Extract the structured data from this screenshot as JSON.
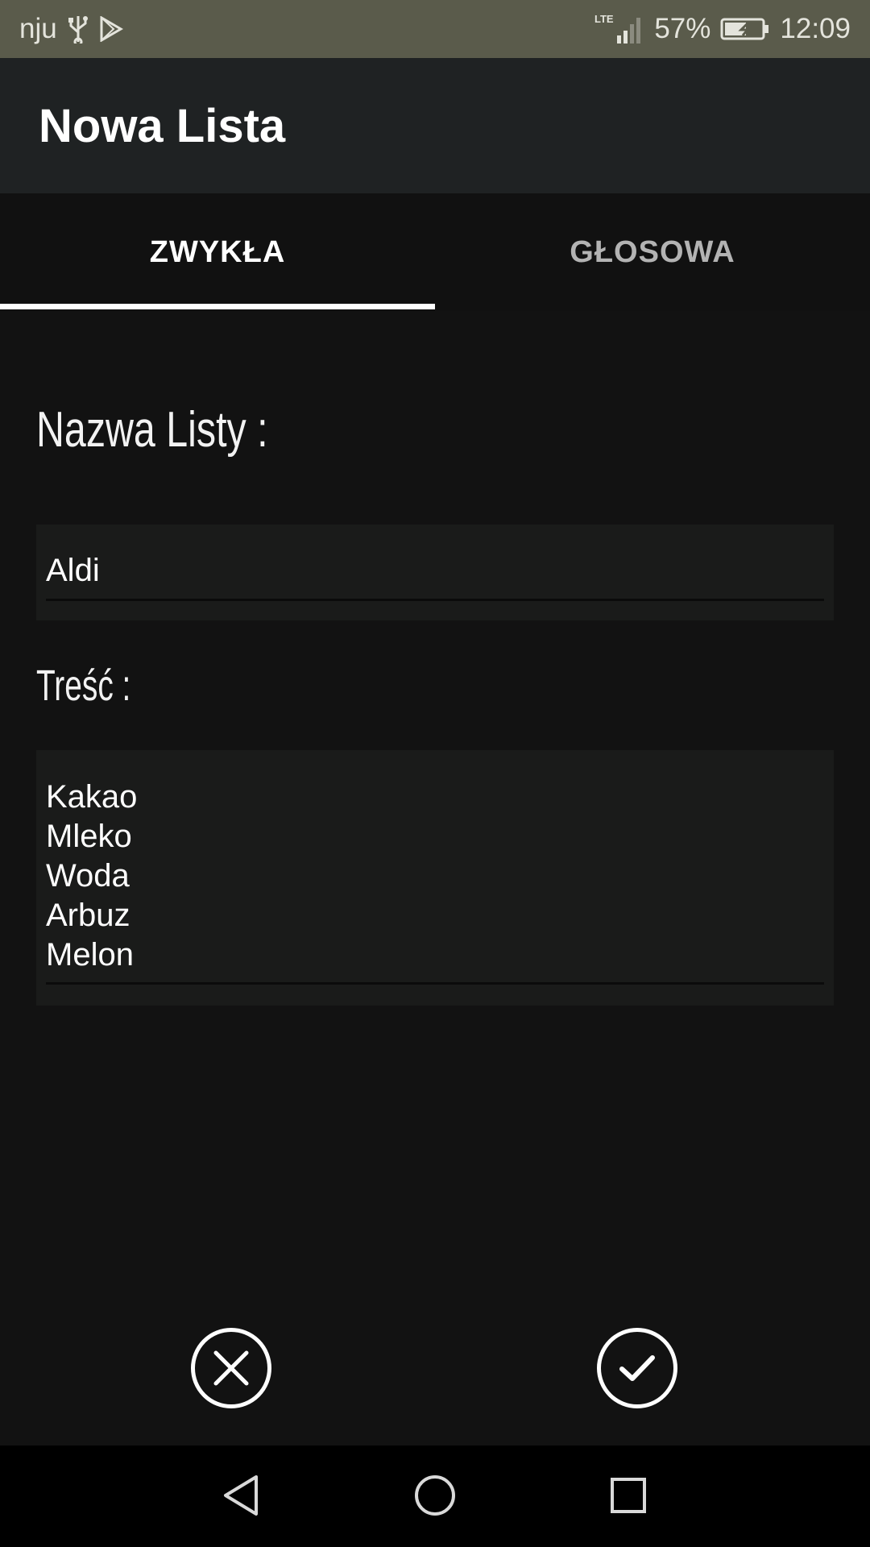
{
  "status_bar": {
    "carrier": "nju",
    "network": "LTE",
    "battery": "57%",
    "time": "12:09",
    "icons": [
      "usb-icon",
      "play-store-icon",
      "signal-icon",
      "battery-charging-icon"
    ]
  },
  "app_bar": {
    "title": "Nowa Lista"
  },
  "tabs": [
    {
      "label": "ZWYKŁA",
      "selected": true
    },
    {
      "label": "GŁOSOWA",
      "selected": false
    }
  ],
  "form": {
    "name_label": "Nazwa Listy :",
    "name_value": "Aldi",
    "content_label": "Treść :",
    "content_lines": [
      "Kakao",
      "Mleko",
      "Woda",
      "Arbuz",
      "Melon"
    ]
  },
  "actions": {
    "cancel_icon": "close-circle-icon",
    "confirm_icon": "check-circle-icon"
  },
  "nav_bar": {
    "icons": [
      "back-icon",
      "home-icon",
      "recents-icon"
    ]
  },
  "colors": {
    "status_bar": "#5a5b4b",
    "app_bar": "#1f2223",
    "background": "#121212",
    "field": "#1a1b1a",
    "accent": "#ffffff"
  }
}
